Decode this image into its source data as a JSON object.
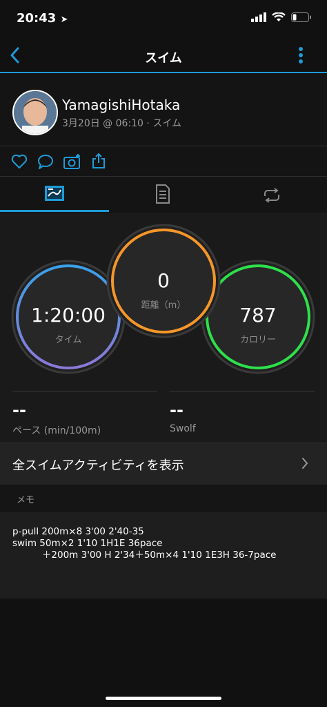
{
  "status": {
    "time": "20:43"
  },
  "nav": {
    "title": "スイム"
  },
  "header": {
    "user_name": "YamagishiHotaka",
    "meta": "3月20日 @ 06:10 · スイム"
  },
  "rings": {
    "time": {
      "value": "1:20:00",
      "label": "タイム"
    },
    "distance": {
      "value": "0",
      "label": "距離（m）"
    },
    "calories": {
      "value": "787",
      "label": "カロリー"
    }
  },
  "stats": {
    "pace": {
      "value": "--",
      "label": "ペース (min/100m)"
    },
    "swolf": {
      "value": "--",
      "label": "Swolf"
    }
  },
  "show_all": {
    "label": "全スイムアクティビティを表示"
  },
  "memo": {
    "header": "メモ",
    "text": "p-pull 200m×8 3'00 2'40-35\nswim 50m×2 1'10 1H1E 36pace\n          ＋200m 3'00 H 2'34＋50m×4 1'10 1E3H 36-7pace"
  },
  "colors": {
    "accent": "#1e9bd7",
    "ring_time_top": "#3aa0e8",
    "ring_time_bottom": "#8c79d8",
    "ring_distance": "#f5962a",
    "ring_calories": "#2ee04b"
  }
}
